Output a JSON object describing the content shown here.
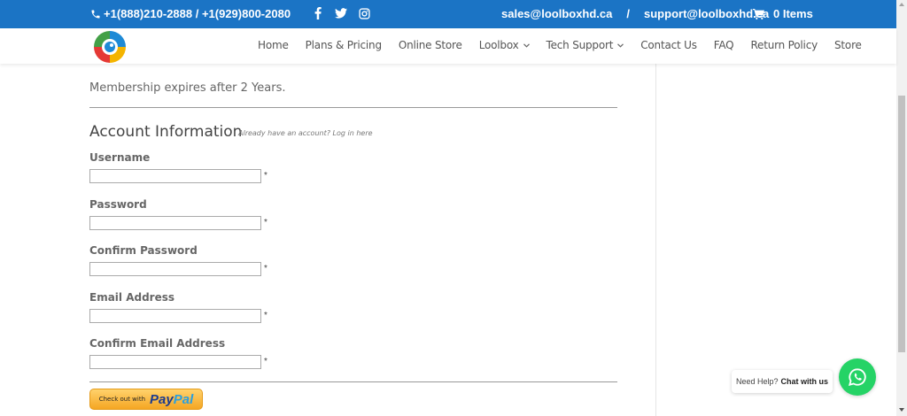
{
  "topbar": {
    "phone": "+1(888)210-2888 / +1(929)800-2080",
    "social": [
      "facebook-icon",
      "twitter-icon",
      "instagram-icon"
    ],
    "email_sales": "sales@loolboxhd.ca",
    "separator": "/",
    "email_support": "support@loolboxhd.ca",
    "cart_label": "0 Items"
  },
  "nav": {
    "items": [
      {
        "label": "Home"
      },
      {
        "label": "Plans & Pricing"
      },
      {
        "label": "Online Store"
      },
      {
        "label": "Loolbox",
        "dropdown": true
      },
      {
        "label": "Tech Support",
        "dropdown": true
      },
      {
        "label": "Contact Us"
      },
      {
        "label": "FAQ"
      },
      {
        "label": "Return Policy"
      },
      {
        "label": "Store"
      }
    ]
  },
  "content": {
    "membership_text": "Membership expires after 2 Years.",
    "account_title": "Account Information",
    "account_note": "Already have an account? Log in here",
    "fields": [
      {
        "label": "Username",
        "value": "",
        "required": "*"
      },
      {
        "label": "Password",
        "value": "",
        "required": "*"
      },
      {
        "label": "Confirm Password",
        "value": "",
        "required": "*"
      },
      {
        "label": "Email Address",
        "value": "",
        "required": "*"
      },
      {
        "label": "Confirm Email Address",
        "value": "",
        "required": "*"
      }
    ],
    "paypal_small": "Check out with",
    "paypal_pay": "Pay",
    "paypal_pal": "Pal"
  },
  "chat": {
    "prefix": "Need Help?",
    "strong": "Chat with us"
  },
  "colors": {
    "topbar": "#1b74c5",
    "whatsapp": "#25d366",
    "paypal_gold": "#f5a623"
  }
}
